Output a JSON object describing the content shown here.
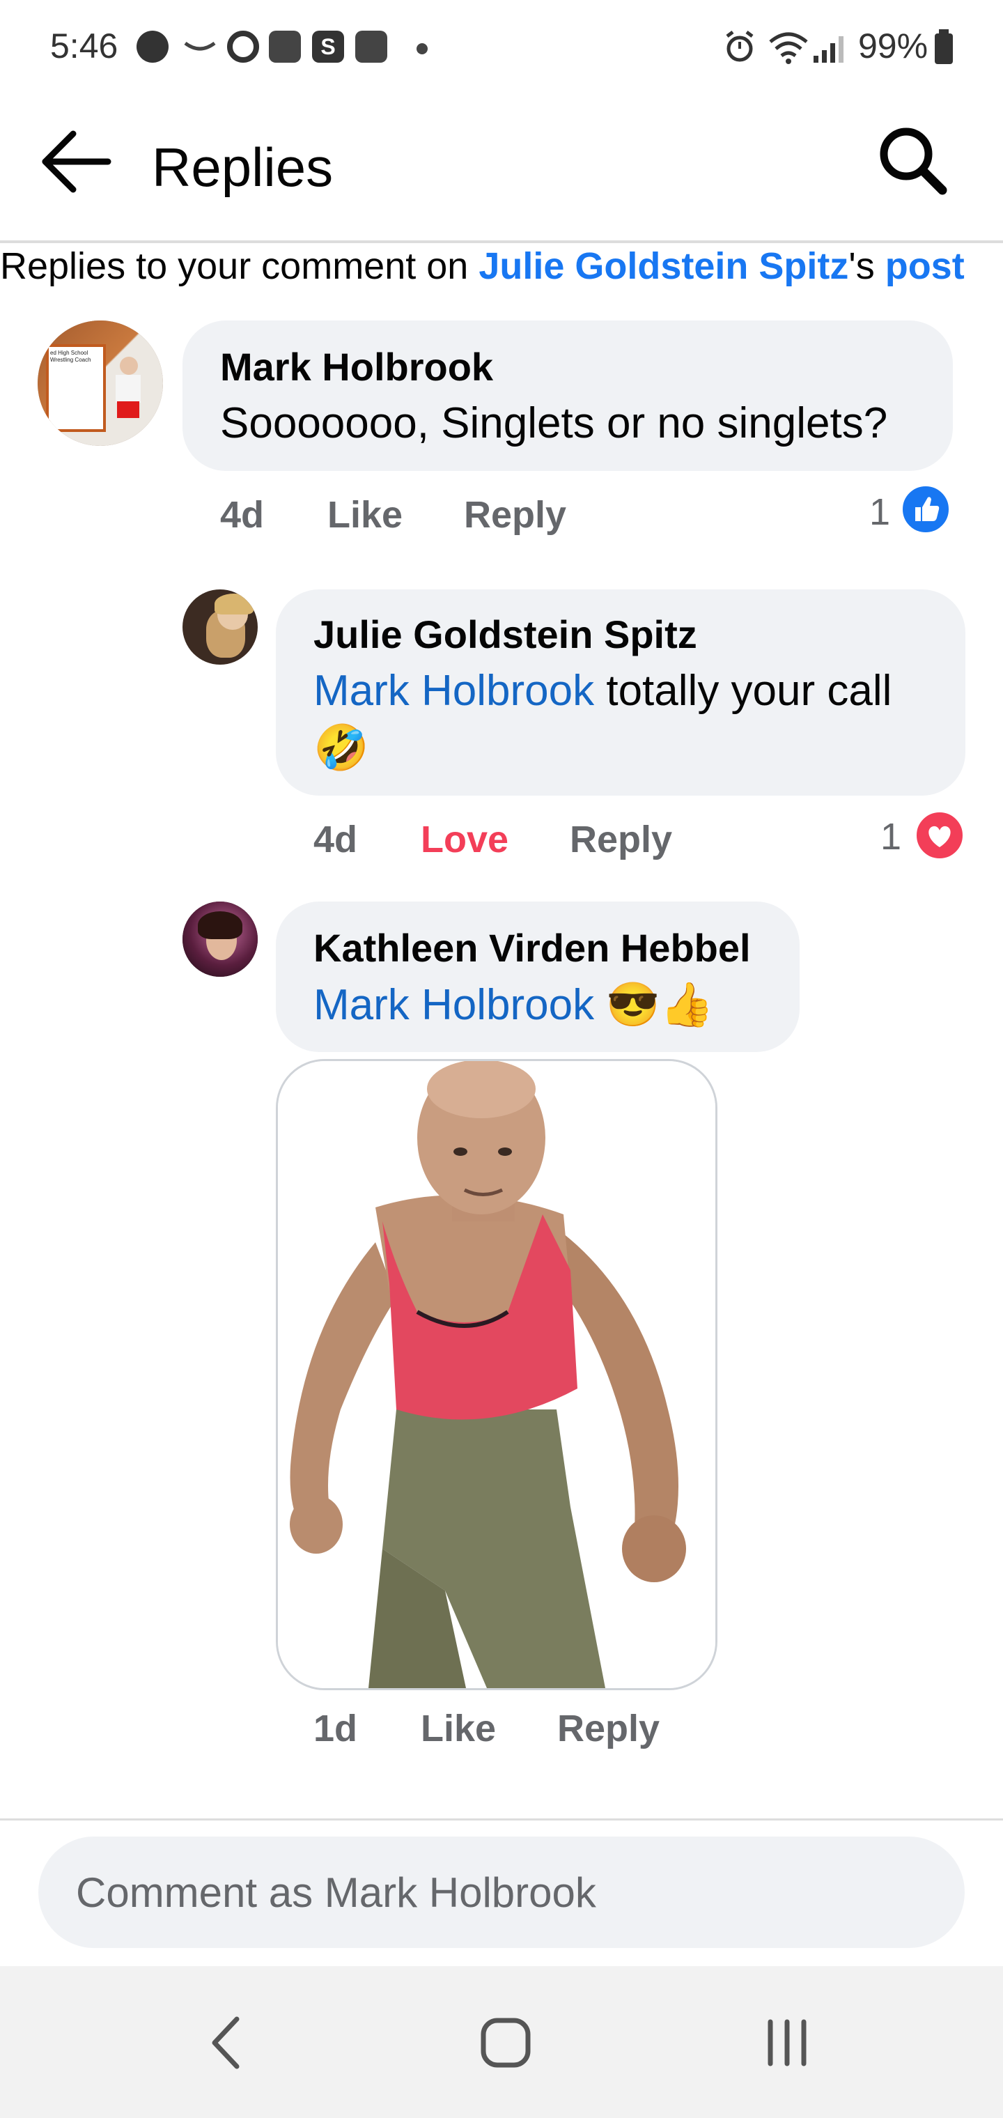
{
  "status_bar": {
    "time": "5:46",
    "battery": "99%",
    "notification_icons": [
      "spotify-icon",
      "amazon-icon",
      "c-app-icon",
      "game-icon",
      "s-app-icon",
      "game-icon",
      "dot-icon"
    ],
    "system_icons": [
      "alarm-icon",
      "wifi-icon",
      "signal-icon",
      "battery-icon"
    ]
  },
  "header": {
    "title": "Replies"
  },
  "context": {
    "prefix": "Replies to your comment on ",
    "post_author": "Julie Goldstein Spitz",
    "possessive": "'s ",
    "post_link": "post"
  },
  "comments": [
    {
      "author": "Mark Holbrook",
      "text": "Sooooooo, Singlets or no singlets?",
      "time": "4d",
      "action": "Like",
      "reply": "Reply",
      "reaction_count": "1",
      "reaction_type": "like",
      "reaction_color": "#1877f2",
      "avatar_text": "ed High School Wrestling Coach"
    },
    {
      "author": "Julie Goldstein Spitz",
      "mention": "Mark Holbrook",
      "text": " totally your call",
      "emoji": "🤣",
      "time": "4d",
      "action": "Love",
      "reply": "Reply",
      "reaction_count": "1",
      "reaction_type": "love",
      "reaction_color": "#f33e58"
    },
    {
      "author": "Kathleen Virden Hebbel",
      "mention": "Mark Holbrook",
      "emoji": "😎👍",
      "time": "1d",
      "action": "Like",
      "reply": "Reply",
      "has_photo": true
    }
  ],
  "composer": {
    "placeholder": "Comment as Mark Holbrook"
  },
  "nav": [
    "back-nav",
    "home-nav",
    "recents-nav"
  ]
}
